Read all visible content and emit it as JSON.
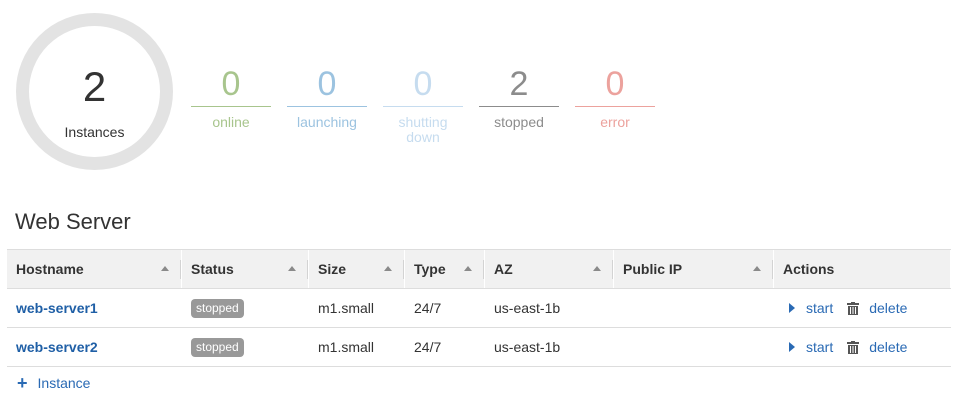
{
  "summary": {
    "total": {
      "count": "2",
      "label": "Instances"
    },
    "stats": [
      {
        "key": "online",
        "count": "0",
        "label": "online",
        "color": "#a8c58d"
      },
      {
        "key": "launching",
        "count": "0",
        "label": "launching",
        "color": "#9cc3e0"
      },
      {
        "key": "shutting_down",
        "count": "0",
        "label": "shutting down",
        "color": "#c6dcef"
      },
      {
        "key": "stopped",
        "count": "2",
        "label": "stopped",
        "color": "#8c8c8c"
      },
      {
        "key": "error",
        "count": "0",
        "label": "error",
        "color": "#eca29d"
      }
    ]
  },
  "section": {
    "title": "Web Server",
    "columns": {
      "hostname": "Hostname",
      "status": "Status",
      "size": "Size",
      "type": "Type",
      "az": "AZ",
      "public_ip": "Public IP",
      "actions": "Actions"
    },
    "rows": [
      {
        "hostname": "web-server1",
        "status": "stopped",
        "size": "m1.small",
        "type": "24/7",
        "az": "us-east-1b",
        "public_ip": "",
        "start": "start",
        "delete": "delete"
      },
      {
        "hostname": "web-server2",
        "status": "stopped",
        "size": "m1.small",
        "type": "24/7",
        "az": "us-east-1b",
        "public_ip": "",
        "start": "start",
        "delete": "delete"
      }
    ],
    "add_label": "Instance"
  },
  "colors": {
    "link": "#2a6ab4",
    "badge": "#999999",
    "ring": "#e3e3e3"
  }
}
